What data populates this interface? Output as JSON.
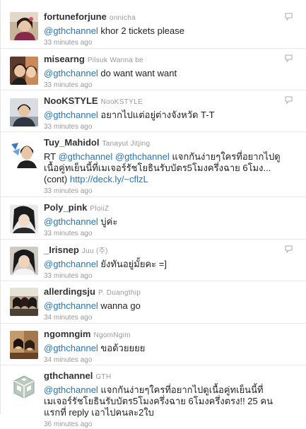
{
  "timeline": {
    "tweets": [
      {
        "screen_name": "fortuneforjune",
        "full_name": "onnicha",
        "mention": "@gthchannel",
        "text": " khor 2 tickets please",
        "time": "33 minutes ago"
      },
      {
        "screen_name": "misearng",
        "full_name": "Pilsuk Wanna be",
        "mention": "@gthchannel",
        "text": " do want want want",
        "time": "33 minutes ago"
      },
      {
        "screen_name": "NooKSTYLE",
        "full_name": "NooKSTYLE",
        "mention": "@gthchannel",
        "text": " อยากไปแต่อยู่ต่างจังหวัด T-T",
        "time": "33 minutes ago"
      },
      {
        "screen_name": "Tuy_Mahidol",
        "full_name": "Tanayut Jitjing",
        "prefix": "RT ",
        "mention": "@gthchannel",
        "mention2": "@gthchannel",
        "text": " แจกกันง่ายๆใครที่อยากไปดูเนื้อคู่ทเย็นนี้ที่เมเจอร์รัชโยธินรับบัตร5โมงครึ่งฉาย 6โมง... (cont) ",
        "link": "http://deck.ly/~cflzL",
        "time": "33 minutes ago"
      },
      {
        "screen_name": "Poly_pink",
        "full_name": "PloiiZ",
        "mention": "@gthchannel",
        "text": " บู่ค่ะ",
        "time": "33 minutes ago"
      },
      {
        "screen_name": "_Irisnep",
        "full_name": "Juu (주)",
        "mention": "@gthchannel",
        "text": " ยังทันอยู่มั้ยคะ =]",
        "time": "33 minutes ago"
      },
      {
        "screen_name": "allerdingsju",
        "full_name": "P. Duangthip",
        "mention": "@gthchannel",
        "text": " wanna go",
        "time": "34 minutes ago"
      },
      {
        "screen_name": "ngomngim",
        "full_name": "NgomNgim",
        "mention": "@gthchannel",
        "text": " ขอด้วยยยย",
        "time": "34 minutes ago"
      },
      {
        "screen_name": "gthchannel",
        "full_name": "GTH",
        "mention": "@gthchannel",
        "text": " แจกกันง่ายๆใครที่อยากไปดูเนื้อคู่ทเย็นนี้ที่เมเจอร์รัชโยธินรับบัตร5โมงครึ่งฉาย 6โมงครึ่งตรง!! 25 คนแรกที่ reply เอาไปคนละ2ใบ",
        "time": "36 minutes ago"
      }
    ]
  },
  "icons": {
    "reply": "reply-speech-bubble-icon",
    "gth_logo": "gth-logo-icon"
  },
  "colors": {
    "mention": "#2276bb",
    "screen_name": "#333333",
    "meta": "#999999",
    "divider": "#e8e8e8"
  }
}
